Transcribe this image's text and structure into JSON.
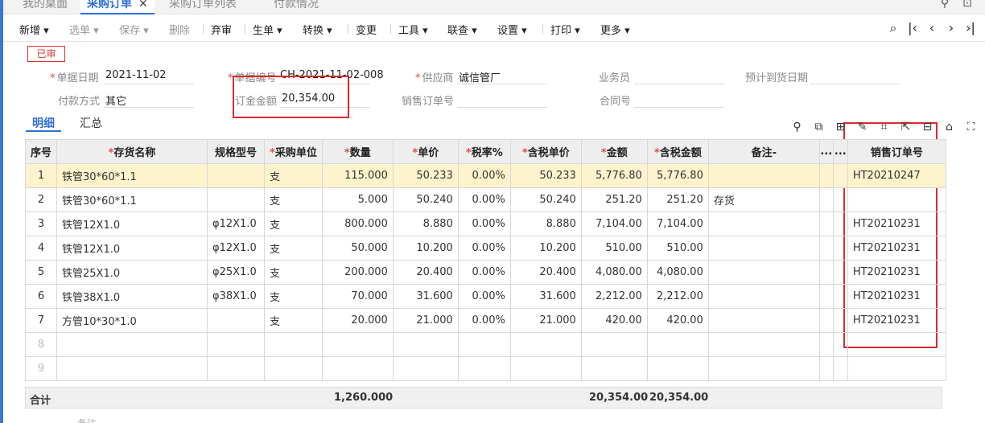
{
  "tabs": [
    {
      "label": "我的桌面",
      "active": false
    },
    {
      "label": "采购订单",
      "active": true,
      "close": "✕"
    },
    {
      "label": "采购订单列表",
      "active": false
    },
    {
      "label": "付款情况",
      "active": false
    }
  ],
  "tab_tools": {
    "search": "⚲",
    "pin": "⊡"
  },
  "toolbar": [
    {
      "label": "新增 ▾",
      "disabled": false
    },
    {
      "label": "选单 ▾",
      "disabled": true
    },
    {
      "label": "保存 ▾",
      "disabled": true
    },
    {
      "label": "删除",
      "disabled": true
    },
    {
      "label": "弃审",
      "disabled": false
    },
    {
      "label": "生单 ▾",
      "disabled": false
    },
    {
      "label": "转换 ▾",
      "disabled": false
    },
    {
      "label": "变更",
      "disabled": false
    },
    {
      "label": "工具 ▾",
      "disabled": false
    },
    {
      "label": "联查 ▾",
      "disabled": false
    },
    {
      "label": "设置 ▾",
      "disabled": false
    },
    {
      "label": "打印 ▾",
      "disabled": false
    },
    {
      "label": "更多 ▾",
      "disabled": false
    }
  ],
  "nav": {
    "find": "⌕",
    "first": "|‹",
    "prev": "‹",
    "next": "›",
    "last": "›|"
  },
  "status_badge": "已审",
  "form": {
    "date_label": "单据日期",
    "date_value": "2021-11-02",
    "code_label": "单据编号",
    "code_value": "CH-2021-11-02-008",
    "supplier_label": "供应商",
    "supplier_value": "诚信管厂",
    "clerk_label": "业务员",
    "clerk_value": "",
    "arrival_label": "预计到货日期",
    "arrival_value": "",
    "payment_label": "付款方式",
    "payment_value": "其它",
    "amount_label": "订金金额",
    "amount_value": "20,354.00",
    "sales_order_label": "销售订单号",
    "sales_order_value": "",
    "contract_label": "合同号",
    "contract_value": ""
  },
  "subtabs": {
    "detail": "明细",
    "summary": "汇总"
  },
  "grid_icons": [
    "pin-icon",
    "copy-icon",
    "import-icon",
    "edit-icon",
    "scan-icon",
    "export-icon",
    "split-icon",
    "home-icon",
    "expand-icon"
  ],
  "grid_icon_glyphs": [
    "⚲",
    "⧉",
    "⊞",
    "✎",
    "⌗",
    "⇱",
    "⊟",
    "⌂",
    "⛶"
  ],
  "table": {
    "headers": [
      "序号",
      "存货名称",
      "规格型号",
      "采购单位",
      "数量",
      "单价",
      "税率%",
      "含税单价",
      "金额",
      "含税金额",
      "备注-",
      "...",
      "...",
      "销售订单号"
    ],
    "rows": [
      [
        "1",
        "铁管30*60*1.1",
        "",
        "支",
        "115.000",
        "50.233",
        "0.00%",
        "50.233",
        "5,776.80",
        "5,776.80",
        "",
        "",
        "",
        "HT20210247"
      ],
      [
        "2",
        "铁管30*60*1.1",
        "",
        "支",
        "5.000",
        "50.240",
        "0.00%",
        "50.240",
        "251.20",
        "251.20",
        "存货",
        "",
        "",
        ""
      ],
      [
        "3",
        "铁管12X1.0",
        "φ12X1.0",
        "支",
        "800.000",
        "8.880",
        "0.00%",
        "8.880",
        "7,104.00",
        "7,104.00",
        "",
        "",
        "",
        "HT20210231"
      ],
      [
        "4",
        "铁管12X1.0",
        "φ12X1.0",
        "支",
        "50.000",
        "10.200",
        "0.00%",
        "10.200",
        "510.00",
        "510.00",
        "",
        "",
        "",
        "HT20210231"
      ],
      [
        "5",
        "铁管25X1.0",
        "φ25X1.0",
        "支",
        "200.000",
        "20.400",
        "0.00%",
        "20.400",
        "4,080.00",
        "4,080.00",
        "",
        "",
        "",
        "HT20210231"
      ],
      [
        "6",
        "铁管38X1.0",
        "φ38X1.0",
        "支",
        "70.000",
        "31.600",
        "0.00%",
        "31.600",
        "2,212.00",
        "2,212.00",
        "",
        "",
        "",
        "HT20210231"
      ],
      [
        "7",
        "方管10*30*1.0",
        "",
        "支",
        "20.000",
        "21.000",
        "0.00%",
        "21.000",
        "420.00",
        "420.00",
        "",
        "",
        "",
        "HT20210231"
      ]
    ],
    "empty_rows": [
      "8",
      "9"
    ]
  },
  "totals": {
    "label": "合计",
    "quantity": "1,260.000",
    "amount": "20,354.00",
    "tax_amount": "20,354.00"
  },
  "bottom_hint": "备注"
}
